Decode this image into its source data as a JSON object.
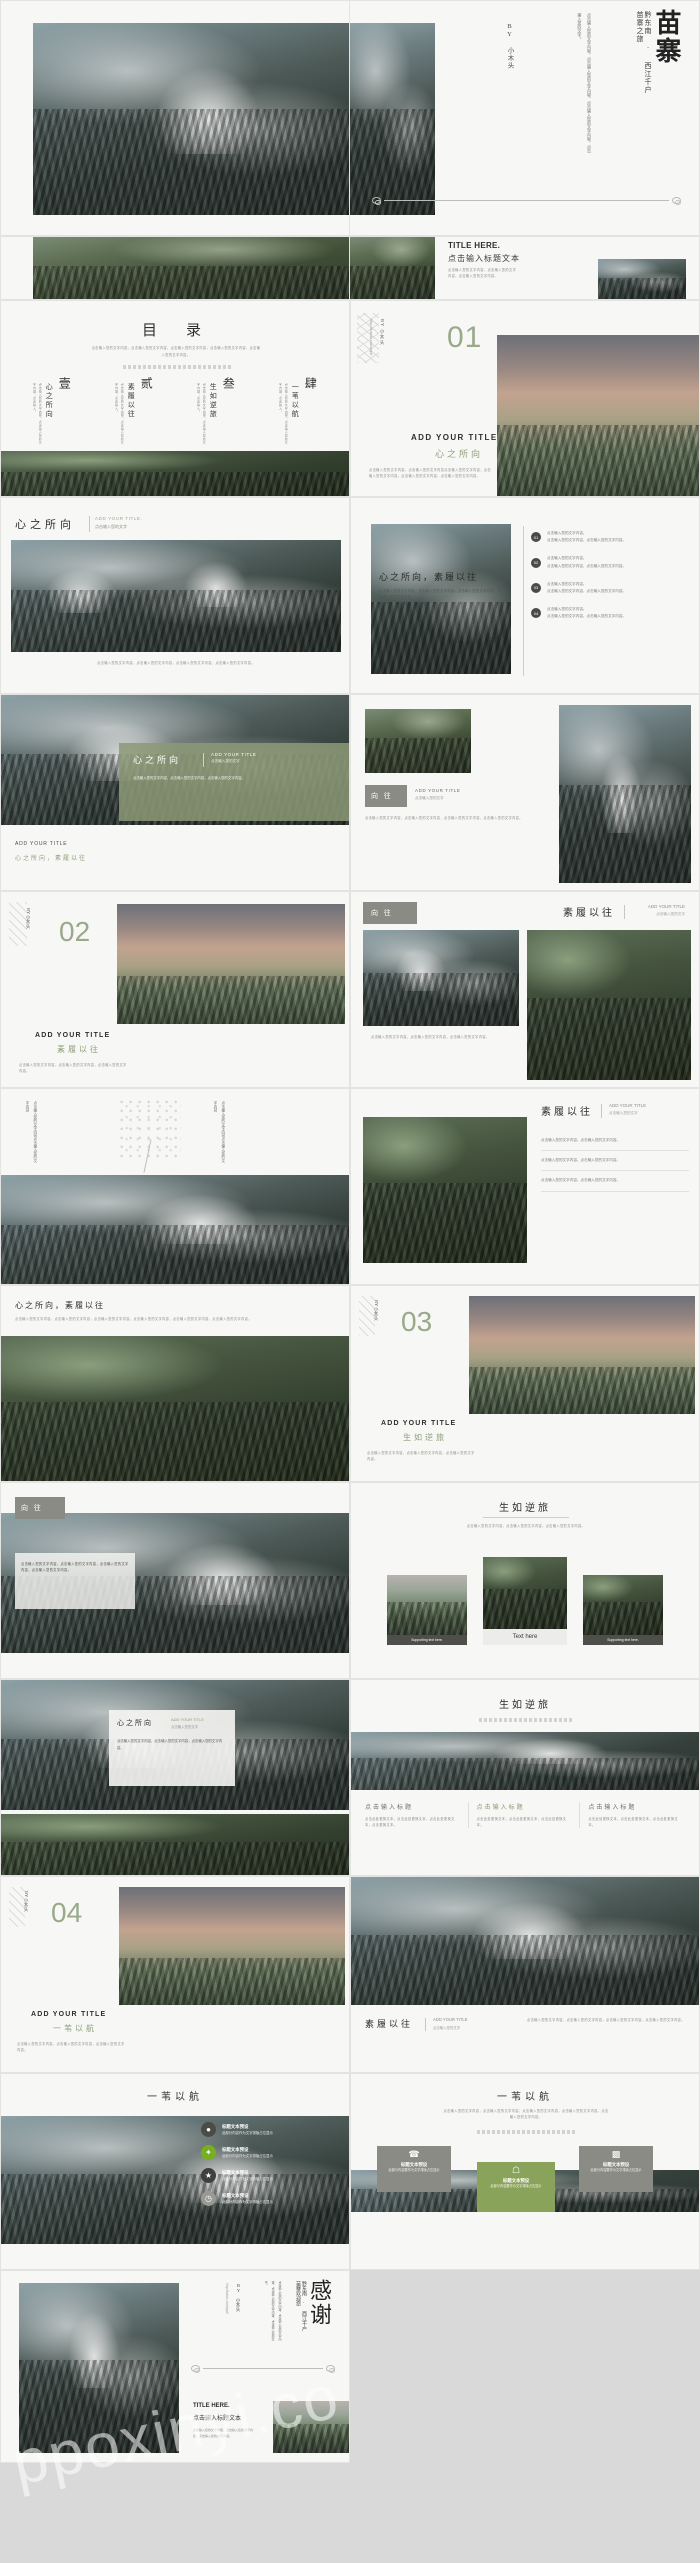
{
  "meta": {
    "watermark": "ppoxinyi.co",
    "theme_accent": "#8aa35a",
    "theme_gray": "#8b8b86",
    "background": "#d9d9d9",
    "slide_bg": "#f7f7f6"
  },
  "common": {
    "body_cn": "点击输入您的文字内容，点击输入您的文字内容，点击输入您的文字内容。",
    "body_cn_long": "点击输入您的文字内容，点击输入您的文字内容，点击输入您的文字内容，点击输入您的文字内容，点击输入您的文字内容。",
    "body_cn_short": "点击输入您的文字内容，点击输入您的文字内容。",
    "add_your_title": "ADD YOUR TITLE",
    "title_here_en": "TITLE HERE.",
    "title_here_cn": "点击输入标题文本",
    "click_input_title": "点击输入标题",
    "placeholder_box": "标题文本预设",
    "placeholder_sub": "此部分内容作为文字排版占位显示",
    "supporting_text": "Supporting text here.",
    "text_here": "Text here",
    "by_line": "BY 小木头",
    "url_line": "http://baidu.com/ppt/",
    "click_replace": "点击此处更换文本，点击此处更换文本，点击此处更换文本。"
  },
  "slides": [
    {
      "id": "cover",
      "title": "苗寨",
      "subtitle_1": "黔东南 · 西江千户",
      "subtitle_2": "苗寨之旅",
      "vertical_body": "点击输入您的文字内容，点击输入您的文字内容，点击输入您的文字内容，点击输入您的文字。",
      "by": "BY 小木头"
    },
    {
      "id": "cover-bottom",
      "en_title": "TITLE HERE.",
      "cn_title": "点击输入标题文本",
      "body": "点击输入您的文字内容，点击输入您的文字内容，点击输入您的文字内容。"
    },
    {
      "id": "toc",
      "title": "目　录",
      "desc": "点击输入您的文字内容，点击输入您的文字内容，点击输入您的文字内容，点击输入您的文字内容，点击输入您的文字内容。",
      "items": [
        {
          "num": "壹",
          "label": "心之所向",
          "note": "点击输入您的文字内容，点击输入您的文字内容，点击输入。"
        },
        {
          "num": "贰",
          "label": "素履以往",
          "note": "点击输入您的文字内容，点击输入您的文字内容，点击输入。"
        },
        {
          "num": "叁",
          "label": "生如逆旅",
          "note": "点击输入您的文字内容，点击输入您的文字内容，点击输入。"
        },
        {
          "num": "肆",
          "label": "一苇以航",
          "note": "点击输入您的文字内容，点击输入您的文字内容，点击输入。"
        }
      ]
    },
    {
      "id": "section-01",
      "number": "01",
      "en_title": "ADD YOUR TITLE",
      "cn_title": "心之所向",
      "body": "点击输入您的文字内容，点击输入您的文字内容点击输入您的文字内容，点击输入您的文字内容，点击输入您的文字内容，点击输入您的文字内容。",
      "by": "BY 小木头",
      "url": "http://baidu.com/ppt/"
    },
    {
      "id": "content-xzsx",
      "cn_title": "心之所向",
      "en_sub": "ADD YOUR TITLE.",
      "cn_sub": "点击输入您的文字",
      "caption": "点击输入您的文字内容，点击输入您的文字内容，点击输入您的文字内容，点击输入您的文字内容。"
    },
    {
      "id": "content-bullets",
      "heading": "心之所向，素履以往",
      "sub": "点击输入您的文字内容，点击输入您的文字内容，点击输入您的文字内容，点击输入您的文字内容。",
      "bullets": [
        {
          "num": "01",
          "line1": "点击输入您的文字内容。",
          "line2": "点击输入您的文字内容，点击输入您的文字内容。"
        },
        {
          "num": "02",
          "line1": "点击输入您的文字内容。",
          "line2": "点击输入您的文字内容，点击输入您的文字内容。"
        },
        {
          "num": "03",
          "line1": "点击输入您的文字内容。",
          "line2": "点击输入您的文字内容，点击输入您的文字内容。"
        },
        {
          "num": "04",
          "line1": "点击输入您的文字内容。",
          "line2": "点击输入您的文字内容，点击输入您的文字内容。"
        }
      ]
    },
    {
      "id": "content-green-panel",
      "cn_title": "心之所向",
      "en_title": "ADD YOUR TITLE",
      "cn_sub": "点击输入您的文字",
      "body": "点击输入您的文字内容，点击输入您的文字内容，点击输入您的文字内容。",
      "footer_en": "ADD YOUR TITLE",
      "footer_cn": "心之所向，素履以往"
    },
    {
      "id": "content-xw",
      "tag": "向 往",
      "en_title": "ADD YOUR TITLE",
      "cn_sub": "点击输入您的文字",
      "body": "点击输入您的文字内容，点击输入您的文字内容，点击输入您的文字内容，点击输入您的文字内容。"
    },
    {
      "id": "section-02",
      "number": "02",
      "en_title": "ADD YOUR TITLE",
      "cn_title": "素履以往",
      "body": "点击输入您的文字内容，点击输入您的文字内容，点击输入您的文字内容。",
      "by": "BY 小木头"
    },
    {
      "id": "content-sy",
      "tag": "向 往",
      "cn_title": "素履以往",
      "en_sub": "ADD YOUR TITLE",
      "cn_sub": "点击输入您的文字",
      "body": "点击输入您的文字内容，点击输入您的文字内容，点击输入您的文字内容。"
    },
    {
      "id": "content-dandelion",
      "vertical_text_1": "点击输入您的文字内容点击输入您的文字内容",
      "vertical_text_2": "点击输入您的文字内容点击输入您的文字内容"
    },
    {
      "id": "content-sy2",
      "cn_title": "素履以往",
      "en_sub": "ADD YOUR TITLE",
      "cn_sub": "点击输入您的文字",
      "rows": [
        "点击输入您的文字内容。点击输入您的文字内容。",
        "点击输入您的文字内容。点击输入您的文字内容。",
        "点击输入您的文字内容。点击输入您的文字内容。"
      ]
    },
    {
      "id": "content-xzsx2",
      "heading": "心之所向，素履以往",
      "body": "点击输入您的文字内容，点击输入您的文字内容，点击输入您的文字内容，点击输入您的文字内容，点击输入您的文字内容，点击输入您的文字内容。"
    },
    {
      "id": "section-03",
      "number": "03",
      "en_title": "ADD YOUR TITLE",
      "cn_title": "生如逆旅",
      "body": "点击输入您的文字内容，点击输入您的文字内容，点击输入您的文字内容。",
      "by": "BY 小木头"
    },
    {
      "id": "content-xw2",
      "tag": "向 往",
      "body": "点击输入您的文字内容，点击输入您的文字内容，点击输入您的文字内容，点击输入您的文字内容。"
    },
    {
      "id": "content-srnl-cards",
      "title": "生如逆旅",
      "desc": "点击输入您的文字内容，点击输入您的文字内容，点击输入您的文字内容。",
      "cards": [
        {
          "caption": "Supporting text here."
        },
        {
          "caption": "Text here"
        },
        {
          "caption": "Supporting text here."
        }
      ]
    },
    {
      "id": "content-xzsx3",
      "cn_title": "心之所向",
      "en_title": "ADD YOUR TITLE",
      "cn_sub": "点击输入您的文字",
      "body": "点击输入您的文字内容，点击输入您的文字内容，点击输入您的文字内容。"
    },
    {
      "id": "content-srnl-3col",
      "title": "生如逆旅",
      "columns": [
        {
          "head": "点击输入标题",
          "body": "点击此处更换文本，点击此处更换文本，点击此处更换文本，点击更换文本。",
          "accent": false
        },
        {
          "head": "点击输入标题",
          "body": "点击此处更换文本，点击此处更换文本，点击此处更换文本。",
          "accent": true
        },
        {
          "head": "点击输入标题",
          "body": "点击此处更换文本，点击此处更换文本，点击此处更换文本。",
          "accent": false
        }
      ]
    },
    {
      "id": "section-04",
      "number": "04",
      "en_title": "ADD YOUR TITLE",
      "cn_title": "一苇以航",
      "body": "点击输入您的文字内容，点击输入您的文字内容，点击输入您的文字内容。",
      "by": "BY 小木头"
    },
    {
      "id": "content-sy3",
      "cn_title": "素履以往",
      "en_sub": "ADD YOUR TITLE",
      "cn_sub": "点击输入您的文字",
      "body": "点击输入您的文字内容，点击输入您的文字内容，点击输入您的文字内容，点击输入您的文字内容。"
    },
    {
      "id": "content-ywyh-list",
      "title": "一苇以航",
      "items": [
        {
          "icon": "user-icon",
          "head": "标题文本预设",
          "body": "此部分内容作为文字排版占位显示",
          "accent": false
        },
        {
          "icon": "leaf-icon",
          "head": "标题文本预设",
          "body": "此部分内容作为文字排版占位显示",
          "accent": true
        },
        {
          "icon": "star-icon",
          "head": "标题文本预设",
          "body": "此部分内容作为文字排版占位显示",
          "accent": false
        },
        {
          "icon": "clock-icon",
          "head": "标题文本预设",
          "body": "此部分内容作为文字排版占位显示",
          "accent": false
        }
      ]
    },
    {
      "id": "content-ywyh-boxes",
      "title": "一苇以航",
      "desc": "点击输入您的文字内容，点击输入您的文字内容，点击输入您的文字内容，点击输入您的文字内容，点击输入您的文字内容。",
      "boxes": [
        {
          "icon": "phone-icon",
          "head": "标题文本预设",
          "body": "此部分内容要作为文字排版占位显示",
          "accent": false
        },
        {
          "icon": "people-icon",
          "head": "标题文本预设",
          "body": "此部分内容要作为文字排版占位显示",
          "accent": true
        },
        {
          "icon": "chart-icon",
          "head": "标题文本预设",
          "body": "此部分内容要作为文字排版占位显示",
          "accent": false
        }
      ]
    },
    {
      "id": "thanks",
      "title": "感谢",
      "subtitle_1": "黔东南 · 西江千户",
      "subtitle_2": "苗寨欢迎您",
      "vertical_body": "点击输入您的文字内容，点击输入您的文字内容，点击输入您的文字内容，点击输入您的文字。",
      "by": "BY 小木头",
      "url": "http://baidu.com/ppt/"
    },
    {
      "id": "thanks-bottom",
      "en_title": "TITLE HERE.",
      "cn_title": "点击输入标题文本",
      "body": "点击输入您的文字内容，点击输入您的文字内容，点击输入您的文字内容。"
    }
  ]
}
